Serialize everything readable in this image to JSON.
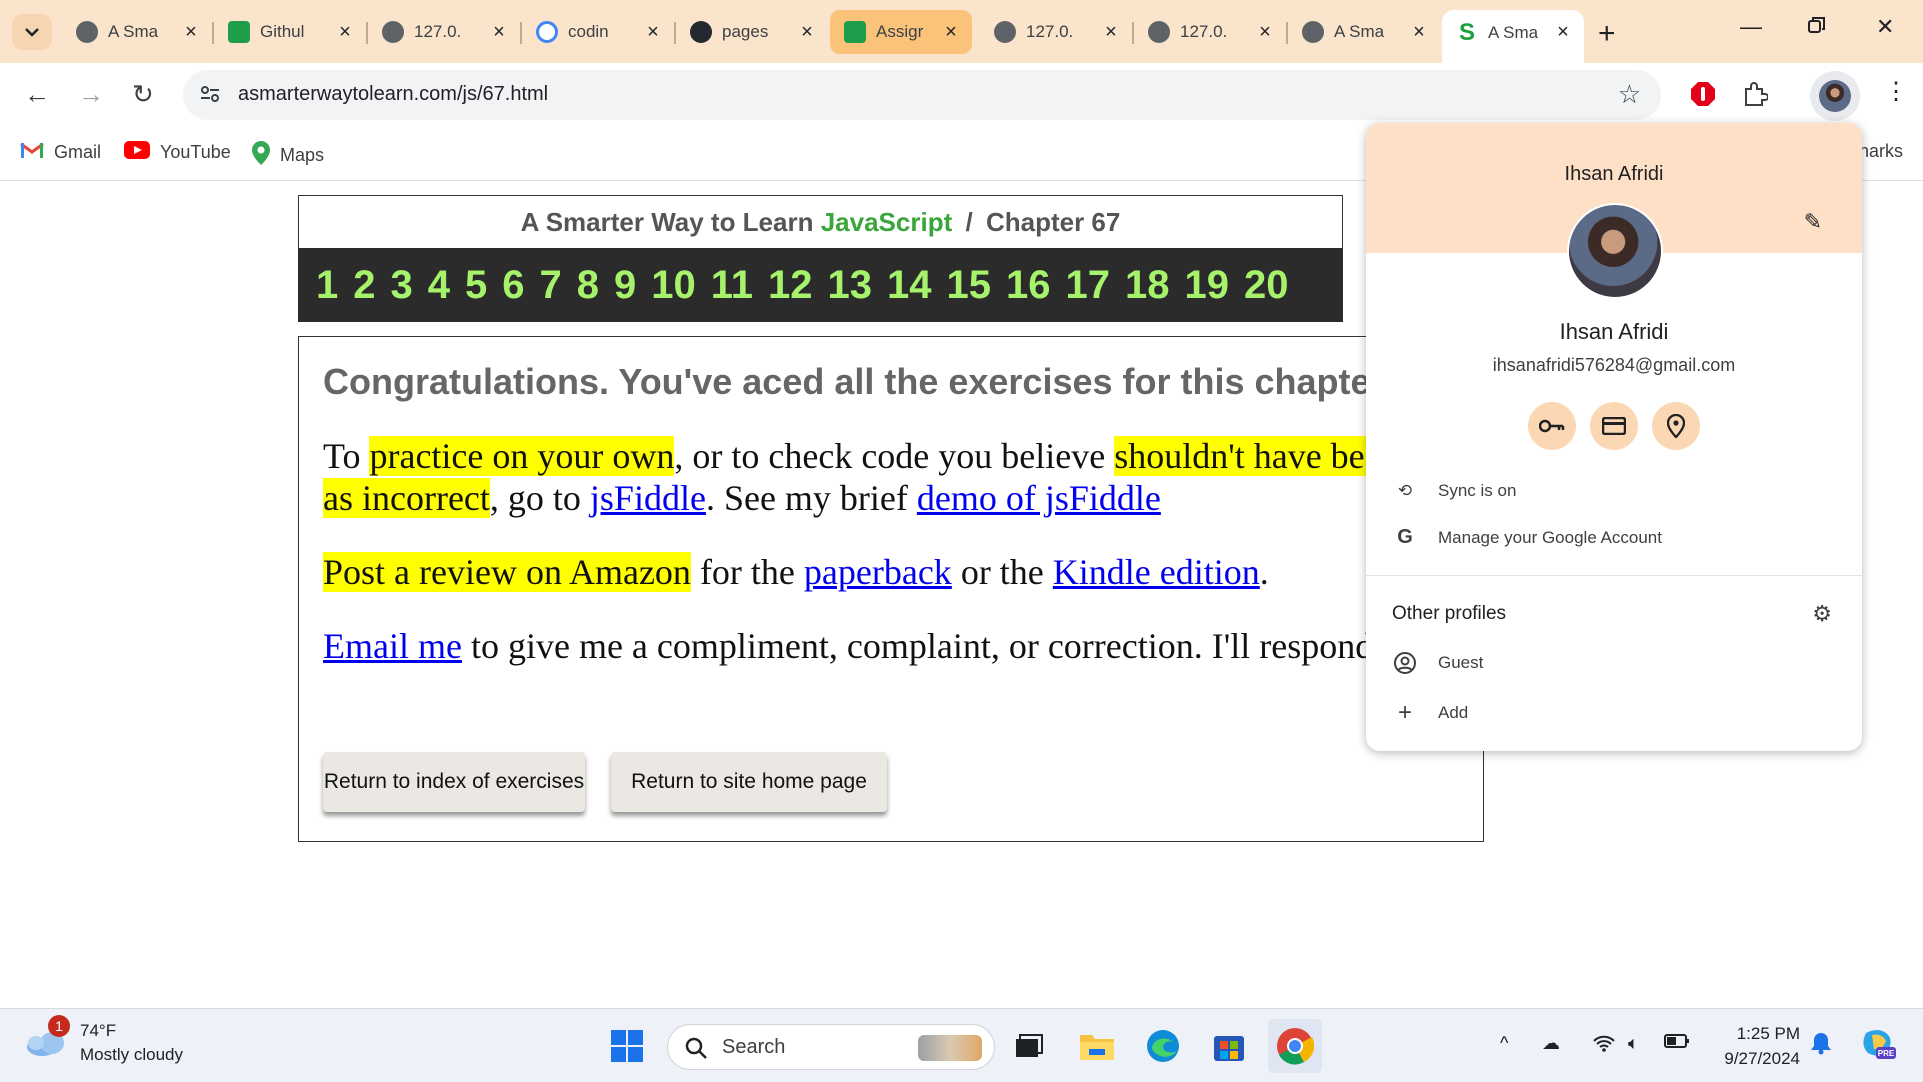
{
  "tabs": [
    {
      "title": "A Sma"
    },
    {
      "title": "Githul"
    },
    {
      "title": "127.0."
    },
    {
      "title": "codin"
    },
    {
      "title": "pages"
    },
    {
      "title": "Assigr"
    },
    {
      "title": "127.0."
    },
    {
      "title": "127.0."
    },
    {
      "title": "A Sma"
    },
    {
      "title": "A Sma"
    }
  ],
  "address": {
    "url": "asmarterwaytolearn.com/js/67.html"
  },
  "bookmarks": {
    "gmail": "Gmail",
    "youtube": "YouTube",
    "maps": "Maps",
    "overflow": "narks"
  },
  "site": {
    "title_prefix": "A Smarter Way to Learn",
    "title_js": "JavaScript",
    "title_sep": "/",
    "title_chapter": "Chapter 67",
    "chapters": [
      "1",
      "2",
      "3",
      "4",
      "5",
      "6",
      "7",
      "8",
      "9",
      "10",
      "11",
      "12",
      "13",
      "14",
      "15",
      "16",
      "17",
      "18",
      "19",
      "20"
    ],
    "congrats": "Congratulations. You've aced all the exercises for this chapter.",
    "p1": {
      "before": "To ",
      "hl1": "practice on your own",
      "mid": ", or to check code you believe ",
      "hl2": "shouldn't have been scored as incorrect",
      "mid2": ", go to ",
      "link1": "jsFiddle",
      "mid3": ". See my brief ",
      "link2": "demo of jsFiddle"
    },
    "p2": {
      "hl": "Post a review on Amazon",
      "mid": " for the ",
      "link1": "paperback",
      "mid2": " or the ",
      "link2": "Kindle edition",
      "end": "."
    },
    "p3": {
      "link": "Email me",
      "rest": " to give me a compliment, complaint, or correction. I'll respond."
    },
    "btn_index": "Return to index of exercises",
    "btn_home": "Return to site home page"
  },
  "profile": {
    "name_header": "Ihsan Afridi",
    "name": "Ihsan Afridi",
    "email": "ihsanafridi576284@gmail.com",
    "sync": "Sync is on",
    "manage": "Manage your Google Account",
    "other_profiles": "Other profiles",
    "guest": "Guest",
    "add": "Add"
  },
  "taskbar": {
    "weather_badge": "1",
    "temp": "74°F",
    "weather": "Mostly cloudy",
    "search": "Search",
    "time": "1:25 PM",
    "date": "9/27/2024"
  },
  "colors": {
    "tabstrip": "#fbe4cc",
    "highlight": "#ffff00",
    "link": "#0000ee",
    "chapter_num": "#a6f26b",
    "js_green": "#3aa53a"
  }
}
